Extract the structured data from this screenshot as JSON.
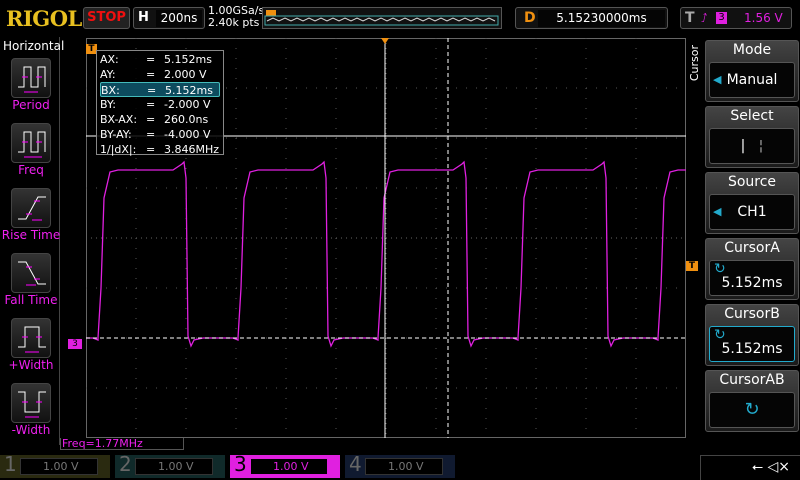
{
  "header": {
    "logo": "RIGOL",
    "run_state": "STOP",
    "timebase_key": "H",
    "timebase": "200ns",
    "sample_rate": "1.00GSa/s",
    "memory_depth": "2.40k pts",
    "delay_key": "D",
    "delay": "5.15230000ms",
    "trigger_key": "T",
    "trigger_source": "3",
    "trigger_level": "1.56 V"
  },
  "left_menu": {
    "title": "Horizontal",
    "items": [
      {
        "label": "Period"
      },
      {
        "label": "Freq"
      },
      {
        "label": "Rise Time"
      },
      {
        "label": "Fall Time"
      },
      {
        "label": "+Width"
      },
      {
        "label": "-Width"
      }
    ]
  },
  "cursor_readout": [
    {
      "k": "AX:",
      "v": "5.152ms"
    },
    {
      "k": "AY:",
      "v": "2.000 V"
    },
    {
      "k": "BX:",
      "v": "5.152ms"
    },
    {
      "k": "BY:",
      "v": "-2.000 V"
    },
    {
      "k": "BX-AX:",
      "v": "260.0ns"
    },
    {
      "k": "BY-AY:",
      "v": "-4.000 V"
    },
    {
      "k": "1/|dX|:",
      "v": "3.846MHz"
    }
  ],
  "eq": "=",
  "measurement": "Freq=1.77MHz",
  "right_menu": {
    "title": "Cursor",
    "mode": {
      "label": "Mode",
      "value": "Manual"
    },
    "select": {
      "label": "Select"
    },
    "source": {
      "label": "Source",
      "value": "CH1"
    },
    "cursor_a": {
      "label": "CursorA",
      "value": "5.152ms"
    },
    "cursor_b": {
      "label": "CursorB",
      "value": "5.152ms"
    },
    "cursor_ab": {
      "label": "CursorAB"
    }
  },
  "channels": [
    {
      "n": "1",
      "scale": "1.00 V"
    },
    {
      "n": "2",
      "scale": "1.00 V"
    },
    {
      "n": "3",
      "scale": "1.00 V"
    },
    {
      "n": "4",
      "scale": "1.00 V"
    }
  ],
  "ch3_marker": "3",
  "trig_marker": "T",
  "colors": {
    "ch3": "#e020e0",
    "trigger": "#f09010",
    "logo": "#e8c020"
  }
}
